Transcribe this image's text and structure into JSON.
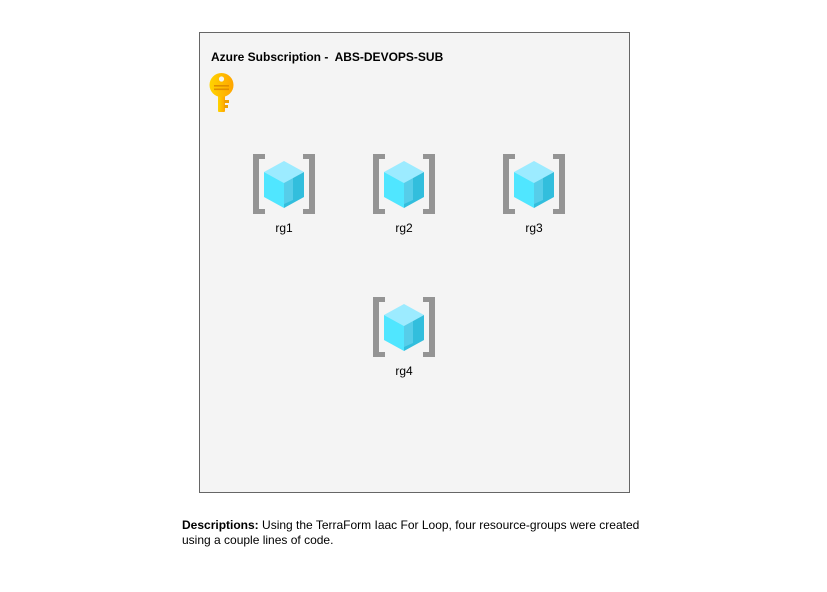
{
  "subscription": {
    "title": "Azure Subscription -  ABS-DEVOPS-SUB",
    "icon": "key-icon"
  },
  "resource_groups": [
    {
      "label": "rg1",
      "icon": "resource-group-icon"
    },
    {
      "label": "rg2",
      "icon": "resource-group-icon"
    },
    {
      "label": "rg3",
      "icon": "resource-group-icon"
    },
    {
      "label": "rg4",
      "icon": "resource-group-icon"
    }
  ],
  "description": {
    "label": "Descriptions:",
    "text": " Using the TerraForm Iaac For Loop, four resource-groups were created using a couple lines of code."
  },
  "colors": {
    "container_bg": "#f4f4f4",
    "container_border": "#666666",
    "bracket": "#949494",
    "cube_light": "#9cebff",
    "cube_mid": "#50e6ff",
    "cube_dark": "#32bedd",
    "key": "#ffb900"
  }
}
